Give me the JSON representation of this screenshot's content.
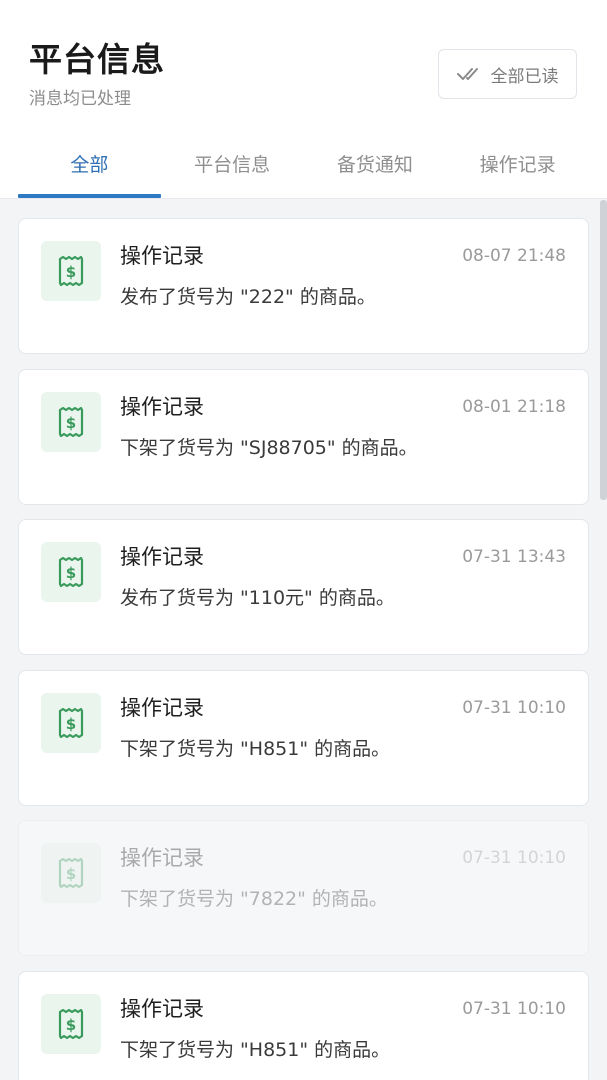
{
  "header": {
    "title": "平台信息",
    "subtitle": "消息均已处理",
    "mark_all_read": "全部已读"
  },
  "tabs": [
    {
      "label": "全部",
      "active": true
    },
    {
      "label": "平台信息",
      "active": false
    },
    {
      "label": "备货通知",
      "active": false
    },
    {
      "label": "操作记录",
      "active": false
    }
  ],
  "messages": [
    {
      "type": "操作记录",
      "time": "08-07 21:48",
      "text": "发布了货号为 \"222\" 的商品。",
      "icon": "dollar-ticket-icon"
    },
    {
      "type": "操作记录",
      "time": "08-01 21:18",
      "text": "下架了货号为 \"SJ88705\" 的商品。",
      "icon": "dollar-ticket-icon"
    },
    {
      "type": "操作记录",
      "time": "07-31 13:43",
      "text": "发布了货号为 \"110元\" 的商品。",
      "icon": "dollar-ticket-icon"
    },
    {
      "type": "操作记录",
      "time": "07-31 10:10",
      "text": "下架了货号为 \"H851\" 的商品。",
      "icon": "dollar-ticket-icon"
    },
    {
      "type": "操作记录",
      "time": "07-31 10:10",
      "text": "下架了货号为 \"7822\" 的商品。",
      "icon": "dollar-ticket-icon"
    },
    {
      "type": "操作记录",
      "time": "07-31 10:10",
      "text": "下架了货号为 \"H851\" 的商品。",
      "icon": "dollar-ticket-icon"
    }
  ],
  "colors": {
    "accent": "#2f78c4",
    "icon_green": "#3a9a5c",
    "icon_bg": "#eaf5ee"
  }
}
